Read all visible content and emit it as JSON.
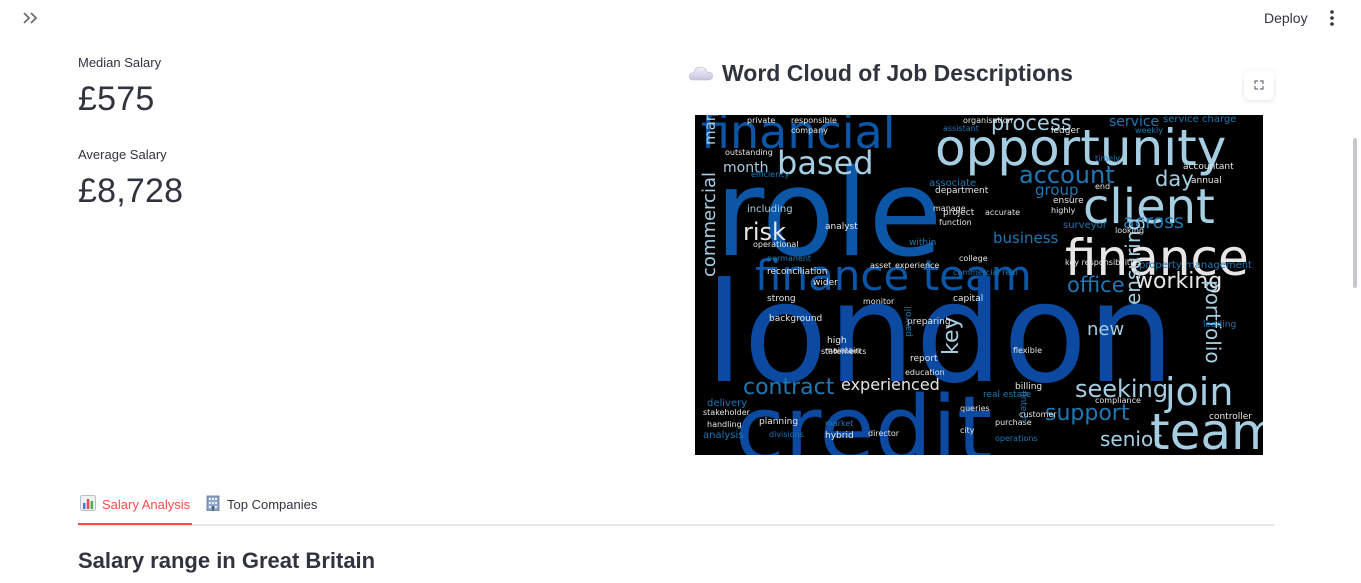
{
  "header": {
    "deploy_label": "Deploy",
    "sidebar_toggle_icon": "double-chevron-right-icon",
    "menu_icon": "vertical-dots-icon"
  },
  "metrics": [
    {
      "label": "Median Salary",
      "value": "£575"
    },
    {
      "label": "Average Salary",
      "value": "£8,728"
    }
  ],
  "word_cloud": {
    "title": "Word Cloud of Job Descriptions",
    "title_icon": "cloud-icon",
    "fullscreen_icon": "fullscreen-icon",
    "words": [
      {
        "t": "financial",
        "c": "#0b56a6"
      },
      {
        "t": "opportunity",
        "c": "#a6cee3"
      },
      {
        "t": "role",
        "c": "#0b56a6"
      },
      {
        "t": "based",
        "c": "#a6cee3"
      },
      {
        "t": "client",
        "c": "#a6cee3"
      },
      {
        "t": "finance",
        "c": "#e6e6e6"
      },
      {
        "t": "finance team",
        "c": "#0b56a6"
      },
      {
        "t": "london",
        "c": "#0b4aa0"
      },
      {
        "t": "credit",
        "c": "#0b4aa0"
      },
      {
        "t": "team",
        "c": "#a6cee3"
      },
      {
        "t": "join",
        "c": "#a6cee3"
      },
      {
        "t": "seeking",
        "c": "#a6cee3"
      },
      {
        "t": "support",
        "c": "#1f78b4"
      },
      {
        "t": "senior",
        "c": "#a6cee3"
      },
      {
        "t": "process",
        "c": "#a6cee3"
      },
      {
        "t": "account",
        "c": "#1f78b4"
      },
      {
        "t": "service",
        "c": "#1f78b4"
      },
      {
        "t": "day",
        "c": "#a6cee3"
      },
      {
        "t": "across",
        "c": "#1f78b4"
      },
      {
        "t": "risk",
        "c": "#e6e6e6"
      },
      {
        "t": "working",
        "c": "#e6e6e6"
      },
      {
        "t": "office",
        "c": "#1f78b4"
      },
      {
        "t": "portfolio",
        "c": "#a6cee3"
      },
      {
        "t": "ensuring",
        "c": "#a6cee3"
      },
      {
        "t": "key",
        "c": "#a6cee3"
      },
      {
        "t": "contract",
        "c": "#1f78b4"
      },
      {
        "t": "experienced",
        "c": "#e6e6e6"
      },
      {
        "t": "month",
        "c": "#a6cee3"
      },
      {
        "t": "management",
        "c": "#a6cee3"
      },
      {
        "t": "commercial",
        "c": "#a6cee3"
      },
      {
        "t": "business",
        "c": "#1f78b4"
      },
      {
        "t": "group",
        "c": "#1f78b4"
      },
      {
        "t": "new",
        "c": "#a6cee3"
      },
      {
        "t": "property management",
        "c": "#1f78b4"
      },
      {
        "t": "service charge",
        "c": "#1f78b4"
      },
      {
        "t": "including",
        "c": "#a6cee3"
      },
      {
        "t": "operational",
        "c": "#e6e6e6"
      },
      {
        "t": "reconciliation",
        "c": "#e6e6e6"
      },
      {
        "t": "asset",
        "c": "#e6e6e6"
      },
      {
        "t": "experience",
        "c": "#e6e6e6"
      },
      {
        "t": "strong",
        "c": "#e6e6e6"
      },
      {
        "t": "high",
        "c": "#e6e6e6"
      },
      {
        "t": "report",
        "c": "#e6e6e6"
      },
      {
        "t": "planning",
        "c": "#e6e6e6"
      },
      {
        "t": "director",
        "c": "#e6e6e6"
      },
      {
        "t": "analysis",
        "c": "#1f78b4"
      },
      {
        "t": "hybrid",
        "c": "#e6e6e6"
      },
      {
        "t": "purchase",
        "c": "#e6e6e6"
      },
      {
        "t": "controller",
        "c": "#e6e6e6"
      },
      {
        "t": "capital",
        "c": "#e6e6e6"
      },
      {
        "t": "outstanding",
        "c": "#e6e6e6"
      },
      {
        "t": "surveyor",
        "c": "#1f78b4"
      },
      {
        "t": "leading",
        "c": "#1f78b4"
      },
      {
        "t": "billing",
        "c": "#e6e6e6"
      },
      {
        "t": "flexible",
        "c": "#e6e6e6"
      },
      {
        "t": "fintech",
        "c": "#1f78b4"
      },
      {
        "t": "real estate",
        "c": "#1f78b4"
      },
      {
        "t": "within",
        "c": "#1f78b4"
      },
      {
        "t": "analyst",
        "c": "#e6e6e6"
      },
      {
        "t": "delivery",
        "c": "#1f78b4"
      },
      {
        "t": "annual",
        "c": "#e6e6e6"
      },
      {
        "t": "accountant",
        "c": "#e6e6e6"
      },
      {
        "t": "compliance",
        "c": "#e6e6e6"
      },
      {
        "t": "associate",
        "c": "#1f78b4"
      },
      {
        "t": "project",
        "c": "#e6e6e6"
      },
      {
        "t": "ledger",
        "c": "#e6e6e6"
      },
      {
        "t": "responsible",
        "c": "#e6e6e6"
      },
      {
        "t": "assistant",
        "c": "#1f78b4"
      },
      {
        "t": "stakeholder",
        "c": "#e6e6e6"
      },
      {
        "t": "handling",
        "c": "#e6e6e6"
      },
      {
        "t": "divisions",
        "c": "#1f78b4"
      },
      {
        "t": "commercial real",
        "c": "#1f78b4"
      },
      {
        "t": "education",
        "c": "#e6e6e6"
      },
      {
        "t": "key responsibilities",
        "c": "#e6e6e6"
      },
      {
        "t": "background",
        "c": "#e6e6e6"
      },
      {
        "t": "permanent",
        "c": "#1f78b4"
      },
      {
        "t": "wider",
        "c": "#e6e6e6"
      },
      {
        "t": "monitor",
        "c": "#e6e6e6"
      },
      {
        "t": "preparing",
        "c": "#e6e6e6"
      },
      {
        "t": "market",
        "c": "#1f78b4"
      },
      {
        "t": "customer",
        "c": "#e6e6e6"
      },
      {
        "t": "accurate",
        "c": "#e6e6e6"
      },
      {
        "t": "department",
        "c": "#e6e6e6"
      },
      {
        "t": "highly",
        "c": "#e6e6e6"
      },
      {
        "t": "college",
        "c": "#e6e6e6"
      },
      {
        "t": "ensure",
        "c": "#e6e6e6"
      },
      {
        "t": "looking",
        "c": "#e6e6e6"
      },
      {
        "t": "statements",
        "c": "#e6e6e6"
      },
      {
        "t": "payroll",
        "c": "#1f78b4"
      },
      {
        "t": "maintain",
        "c": "#e6e6e6"
      },
      {
        "t": "efficiency",
        "c": "#1f78b4"
      },
      {
        "t": "company",
        "c": "#e6e6e6"
      },
      {
        "t": "private",
        "c": "#e6e6e6"
      },
      {
        "t": "end",
        "c": "#e6e6e6"
      },
      {
        "t": "organisation",
        "c": "#e6e6e6"
      },
      {
        "t": "queries",
        "c": "#e6e6e6"
      },
      {
        "t": "city",
        "c": "#e6e6e6"
      },
      {
        "t": "operations",
        "c": "#1f78b4"
      },
      {
        "t": "manage",
        "c": "#e6e6e6"
      },
      {
        "t": "function",
        "c": "#e6e6e6"
      },
      {
        "t": "timely",
        "c": "#1f78b4"
      },
      {
        "t": "weekly",
        "c": "#1f78b4"
      }
    ]
  },
  "tabs": [
    {
      "label": "Salary Analysis",
      "icon": "bar-chart-icon",
      "active": true
    },
    {
      "label": "Top Companies",
      "icon": "office-building-icon",
      "active": false
    }
  ],
  "section": {
    "title": "Salary range in Great Britain"
  }
}
